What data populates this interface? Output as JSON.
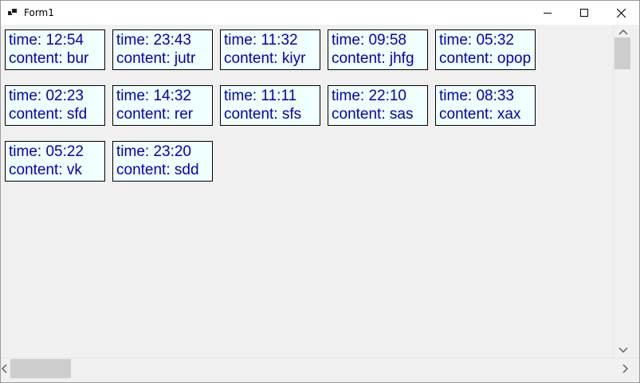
{
  "window": {
    "title": "Form1",
    "controls": {
      "minimize_icon": "minimize-icon",
      "maximize_icon": "maximize-icon",
      "close_icon": "close-icon"
    }
  },
  "cards": [
    {
      "time": "time: 12:54",
      "content": "content: bur"
    },
    {
      "time": "time: 23:43",
      "content": "content: jutr"
    },
    {
      "time": "time: 11:32",
      "content": "content: kiyr"
    },
    {
      "time": "time: 09:58",
      "content": "content: jhfg"
    },
    {
      "time": "time: 05:32",
      "content": "content: opop"
    },
    {
      "time": "time: 02:23",
      "content": "content: sfd"
    },
    {
      "time": "time: 14:32",
      "content": "content: rer"
    },
    {
      "time": "time: 11:11",
      "content": "content: sfs"
    },
    {
      "time": "time: 22:10",
      "content": "content: sas"
    },
    {
      "time": "time: 08:33",
      "content": "content: xax"
    },
    {
      "time": "time: 05:22",
      "content": "content: vk"
    },
    {
      "time": "time: 23:20",
      "content": "content: sdd"
    }
  ],
  "colors": {
    "card_background": "#f0ffff",
    "card_text": "#0000b8",
    "card_border": "#000000",
    "form_background": "#f0f0f0"
  }
}
